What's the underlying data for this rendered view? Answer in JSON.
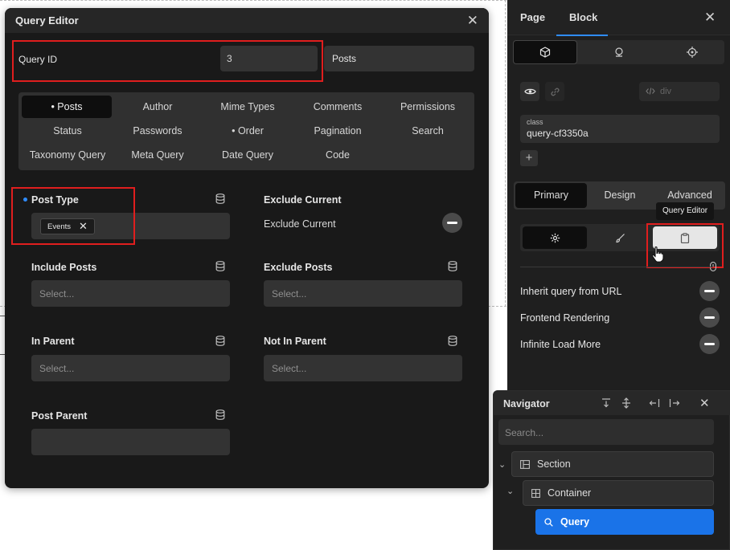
{
  "query_editor": {
    "title": "Query Editor",
    "close_glyph": "✕",
    "query_id_label": "Query ID",
    "query_id_value": "3",
    "query_type_value": "Posts",
    "tabs": [
      {
        "label": "• Posts",
        "active": true
      },
      {
        "label": "Author"
      },
      {
        "label": "Mime Types"
      },
      {
        "label": "Comments"
      },
      {
        "label": "Permissions"
      },
      {
        "label": "Status"
      },
      {
        "label": "Passwords"
      },
      {
        "label": "• Order"
      },
      {
        "label": "Pagination"
      },
      {
        "label": "Search"
      },
      {
        "label": "Taxonomy Query"
      },
      {
        "label": "Meta Query"
      },
      {
        "label": "Date Query"
      },
      {
        "label": "Code"
      }
    ],
    "post_type": {
      "label": "Post Type",
      "chip": "Events",
      "chip_remove": "✕"
    },
    "exclude_current": {
      "label": "Exclude Current",
      "toggle_label": "Exclude Current"
    },
    "include_posts": {
      "label": "Include Posts",
      "placeholder": "Select..."
    },
    "exclude_posts": {
      "label": "Exclude Posts",
      "placeholder": "Select..."
    },
    "in_parent": {
      "label": "In Parent",
      "placeholder": "Select..."
    },
    "not_in_parent": {
      "label": "Not In Parent",
      "placeholder": "Select..."
    },
    "post_parent": {
      "label": "Post Parent",
      "value": ""
    }
  },
  "right_panel": {
    "tabs": {
      "page": "Page",
      "block": "Block"
    },
    "close_glyph": "✕",
    "tag_field": "div",
    "class_caption": "class",
    "class_value": "query-cf3350a",
    "plus": "+",
    "sections": {
      "primary": "Primary",
      "design": "Design",
      "advanced": "Advanced"
    },
    "tooltip": "Query Editor",
    "options": [
      {
        "label": "Inherit query from URL"
      },
      {
        "label": "Frontend Rendering"
      },
      {
        "label": "Infinite Load More"
      }
    ]
  },
  "navigator": {
    "title": "Navigator",
    "close_glyph": "✕",
    "search_placeholder": "Search...",
    "items": [
      {
        "label": "Section"
      },
      {
        "label": "Container"
      },
      {
        "label": "Query",
        "selected": true
      }
    ]
  },
  "colors": {
    "accent": "#1a73e8",
    "highlight": "#e01e1e"
  }
}
